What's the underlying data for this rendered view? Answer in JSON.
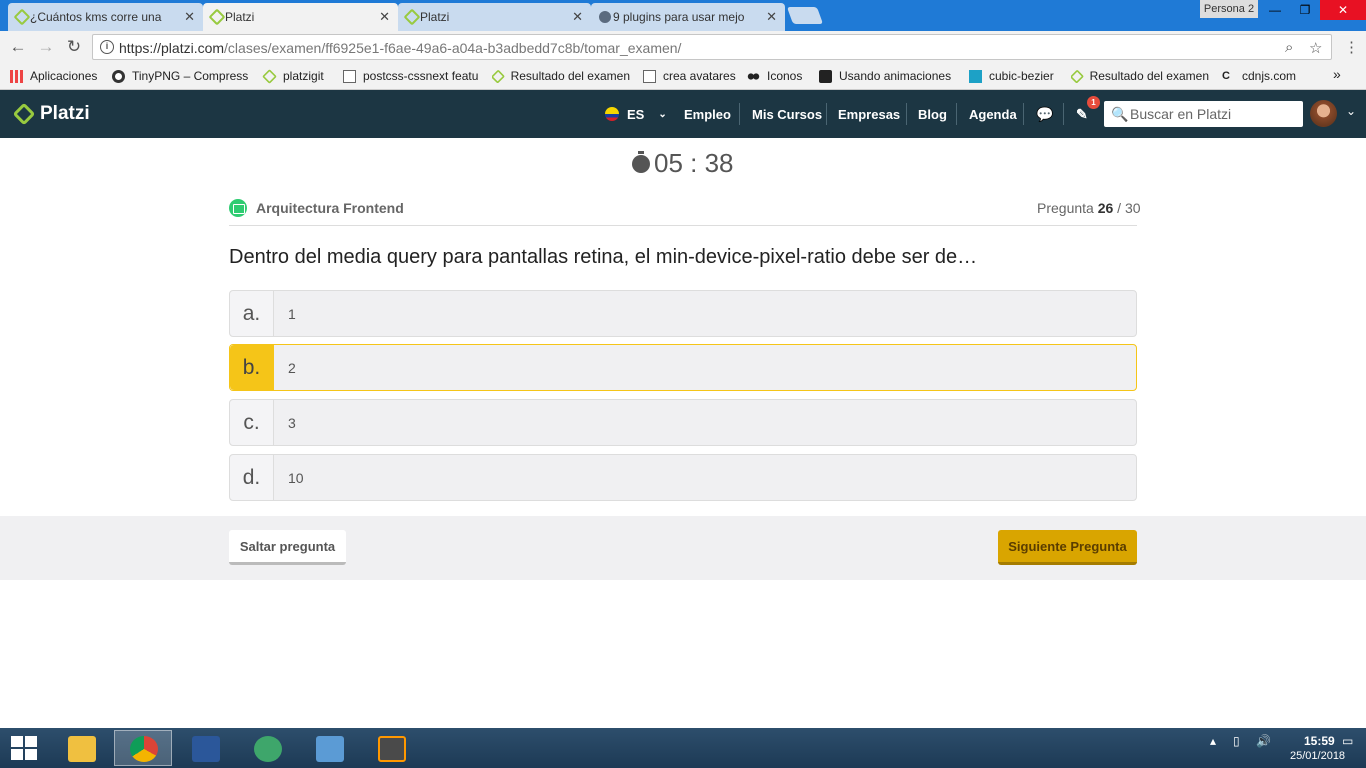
{
  "browser": {
    "tabs": [
      {
        "title": "¿Cuántos kms corre una",
        "icon": "platzi-leaf-icon",
        "active": false
      },
      {
        "title": "Platzi",
        "icon": "platzi-leaf-icon",
        "active": true
      },
      {
        "title": "Platzi",
        "icon": "platzi-leaf-icon",
        "active": false
      },
      {
        "title": "9 plugins para usar mejo",
        "icon": "fish-icon",
        "active": false
      }
    ],
    "close_glyph": "✕",
    "profile": "Persona 2",
    "url_host": "https://platzi.com",
    "url_path": "/clases/examen/ff6925e1-f6ae-49a6-a04a-b3adbedd7c8b/tomar_examen/",
    "bookmarks": [
      {
        "label": "Aplicaciones",
        "icon": "apps-grid-icon"
      },
      {
        "label": "TinyPNG – Compress",
        "icon": "panda-icon"
      },
      {
        "label": "platzigit",
        "icon": "platzi-leaf-icon"
      },
      {
        "label": "postcss-cssnext featu",
        "icon": "postcss-icon"
      },
      {
        "label": "Resultado del examen",
        "icon": "platzi-leaf-icon"
      },
      {
        "label": "crea avatares",
        "icon": "document-icon"
      },
      {
        "label": "Iconos",
        "icon": "eyes-icon"
      },
      {
        "label": "Usando animaciones",
        "icon": "sass-icon"
      },
      {
        "label": "cubic-bezier",
        "icon": "curve-icon"
      },
      {
        "label": "Resultado del examen",
        "icon": "platzi-leaf-icon"
      },
      {
        "label": "cdnjs.com",
        "icon": "cdnjs-icon"
      }
    ],
    "bookmarks_overflow": "»"
  },
  "header": {
    "logo_text": "Platzi",
    "language": "ES",
    "nav": [
      "Empleo",
      "Mis Cursos",
      "Empresas",
      "Blog",
      "Agenda"
    ],
    "notification_count": "1",
    "search_placeholder": "Buscar en Platzi"
  },
  "exam": {
    "timer": "05 : 38",
    "course": "Arquitectura Frontend",
    "question_label": "Pregunta",
    "question_number": "26",
    "question_sep": " / ",
    "question_total": "30",
    "question_text": "Dentro del media query para pantallas retina, el min-device-pixel-ratio debe ser de…",
    "options": [
      {
        "letter": "a.",
        "text": "1",
        "selected": false
      },
      {
        "letter": "b.",
        "text": "2",
        "selected": true
      },
      {
        "letter": "c.",
        "text": "3",
        "selected": false
      },
      {
        "letter": "d.",
        "text": "10",
        "selected": false
      }
    ],
    "skip_label": "Saltar pregunta",
    "next_label": "Siguiente Pregunta"
  },
  "taskbar": {
    "apps": [
      "file-explorer-icon",
      "chrome-icon",
      "word-icon",
      "atom-icon",
      "photos-icon",
      "sublime-text-icon"
    ],
    "time": "15:59",
    "date": "25/01/2018"
  },
  "colors": {
    "platzi_header": "#1c3643",
    "platzi_green": "#98ca3f",
    "selected_option": "#f5c518",
    "next_button": "#d9a500"
  }
}
